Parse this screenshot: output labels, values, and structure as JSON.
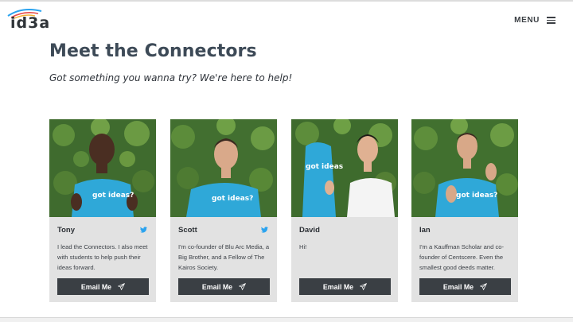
{
  "header": {
    "logo_text": "id3a",
    "menu_label": "MENU"
  },
  "main": {
    "title": "Meet the Connectors",
    "subtitle": "Got something you wanna try? We're here to help!"
  },
  "connectors": [
    {
      "name": "Tony",
      "bio": "I lead the Connectors. I also meet with students to help push their ideas forward.",
      "has_twitter": true,
      "button_label": "Email Me",
      "shirt_text": "got ideas?"
    },
    {
      "name": "Scott",
      "bio": "I'm co-founder of Blu Arc Media, a Big Brother, and a Fellow of The Kairos Society.",
      "has_twitter": true,
      "button_label": "Email Me",
      "shirt_text": "got ideas?"
    },
    {
      "name": "David",
      "bio": "Hi!",
      "has_twitter": false,
      "button_label": "Email Me",
      "shirt_text": "got ideas"
    },
    {
      "name": "Ian",
      "bio": "I'm a Kauffman Scholar and co-founder of Centscere. Even the smallest good deeds matter.",
      "has_twitter": false,
      "button_label": "Email Me",
      "shirt_text": "got ideas?"
    }
  ],
  "colors": {
    "card_bg": "#e2e2e2",
    "button_bg": "#3a3f44",
    "twitter_blue": "#2aa3ef",
    "title_color": "#3d4a57",
    "shirt_blue": "#2fa8d8"
  }
}
